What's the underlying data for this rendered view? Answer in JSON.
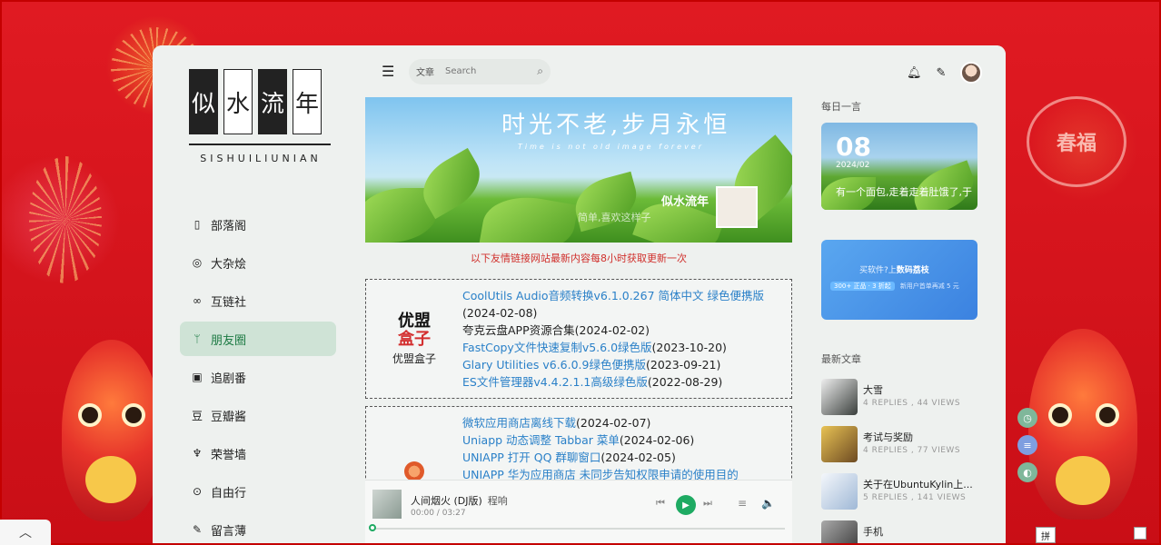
{
  "site": {
    "logo_chars": [
      "似",
      "水",
      "流",
      "年"
    ],
    "logo_subtitle": "SISHUILIUNIAN"
  },
  "nav": {
    "items": [
      {
        "label": "部落阁",
        "icon": "book-icon",
        "glyph": "▯"
      },
      {
        "label": "大杂烩",
        "icon": "swirl-icon",
        "glyph": "◎"
      },
      {
        "label": "互链社",
        "icon": "link-icon",
        "glyph": "∞"
      },
      {
        "label": "朋友圈",
        "icon": "sprout-icon",
        "glyph": "ᛘ",
        "active": true
      },
      {
        "label": "追剧番",
        "icon": "tv-icon",
        "glyph": "▣"
      },
      {
        "label": "豆瓣酱",
        "icon": "douban-icon",
        "glyph": "豆"
      },
      {
        "label": "荣誉墙",
        "icon": "trophy-icon",
        "glyph": "♆"
      },
      {
        "label": "自由行",
        "icon": "map-icon",
        "glyph": "⊙"
      },
      {
        "label": "留言薄",
        "icon": "edit-icon",
        "glyph": "✎"
      }
    ]
  },
  "search": {
    "category": "文章",
    "placeholder": "Search"
  },
  "banner": {
    "title": "时光不老,步月永恒",
    "subtitle": "Time is not old image forever",
    "name": "似水流年",
    "motto": "简单,喜欢这样子"
  },
  "notice": "以下友情链接网站最新内容每8小时获取更新一次",
  "friends": [
    {
      "site_name": "优盟盒子",
      "logo_top": "优盟",
      "logo_bottom": "盒子",
      "posts": [
        {
          "title": "CoolUtils Audio音频转换v6.1.0.267 简体中文 绿色便携版",
          "date": "",
          "dark": false
        },
        {
          "title": "",
          "date": "(2024-02-08)",
          "dark": true
        },
        {
          "title": "夸克云盘APP资源合集",
          "date": "(2024-02-02)",
          "dark": true
        },
        {
          "title": "FastCopy文件快速复制v5.6.0绿色版",
          "date": "(2023-10-20)",
          "dark": false
        },
        {
          "title": "Glary Utilities v6.6.0.9绿色便携版",
          "date": "(2023-09-21)",
          "dark": false
        },
        {
          "title": "ES文件管理器v4.4.2.1.1高级绿色版",
          "date": "(2022-08-29)",
          "dark": false
        }
      ]
    },
    {
      "site_name": "",
      "logo_top": "",
      "logo_bottom": "",
      "posts": [
        {
          "title": "微软应用商店离线下载",
          "date": "(2024-02-07)",
          "dark": false
        },
        {
          "title": "Uniapp 动态调整 Tabbar 菜单",
          "date": "(2024-02-06)",
          "dark": false
        },
        {
          "title": "UNIAPP 打开 QQ 群聊窗口",
          "date": "(2024-02-05)",
          "dark": false
        },
        {
          "title": "UNIAPP 华为应用商店 未同步告知权限申请的使用目的",
          "date": "",
          "dark": false
        }
      ]
    }
  ],
  "player": {
    "song": "人间烟火 (DJ版)",
    "artist": "程响",
    "time": "00:00 / 03:27",
    "progress": 0
  },
  "sidebar_right": {
    "daily_title": "每日一言",
    "daily": {
      "day": "08",
      "month": "2024/02",
      "text": "有一个面包,走着走着肚饿了,于是就把自己吃了"
    },
    "ad": {
      "line1_pre": "买软件?上",
      "line1_brand": "数码荔枝",
      "line2_pill": "300+ 正品 · 3 折起",
      "line2_rest": "新用户首单再减 5 元"
    },
    "latest_title": "最新文章",
    "posts": [
      {
        "title": "大雪",
        "meta": "4 REPLIES ,  44 VIEWS",
        "thumb": "#3a3f3c"
      },
      {
        "title": "考试与奖励",
        "meta": "4 REPLIES ,  77 VIEWS",
        "thumb": "#c9a23a"
      },
      {
        "title": "关于在UbuntuKylin上...",
        "meta": "5 REPLIES ,  141 VIEWS",
        "thumb": "#dfe8f2"
      },
      {
        "title": "手机",
        "meta": "",
        "thumb": "#4a4a4a"
      }
    ]
  },
  "ime": {
    "label": "拼"
  },
  "colors": {
    "accent": "#1eaa62",
    "nav_active_bg": "#cfe3d6",
    "link": "#2a80c8",
    "notice": "#d0302c",
    "page_bg": "#d8111a"
  }
}
